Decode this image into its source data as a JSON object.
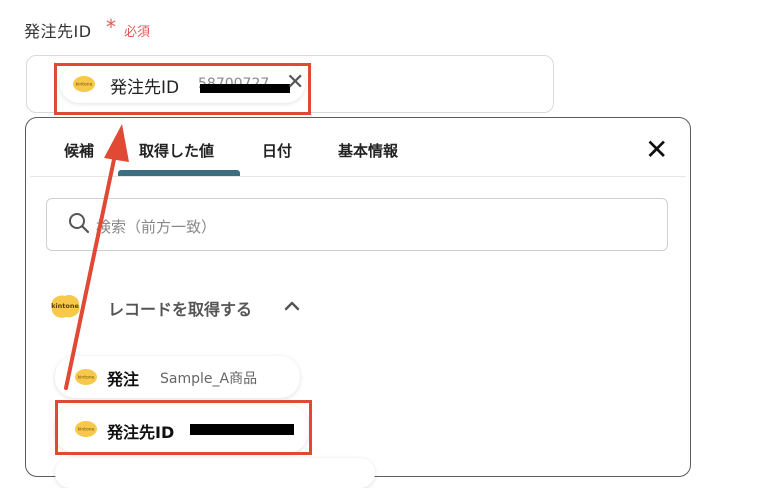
{
  "field": {
    "label": "発注先ID",
    "required_mark": "*",
    "required_text": "必須"
  },
  "selected_chip": {
    "label": "発注先ID",
    "value_partial": "58700727",
    "close_glyph": "✕",
    "icon": "kintone-icon"
  },
  "panel": {
    "tabs": [
      {
        "label": "候補",
        "active": false
      },
      {
        "label": "取得した値",
        "active": true
      },
      {
        "label": "日付",
        "active": false
      },
      {
        "label": "基本情報",
        "active": false
      }
    ],
    "close_glyph": "✕",
    "search": {
      "placeholder": "検索（前方一致）",
      "value": ""
    },
    "group": {
      "logo_text": "kintone",
      "title": "レコードを取得する",
      "expanded": true
    },
    "items": [
      {
        "label": "発注",
        "value": "Sample_A商品"
      },
      {
        "label": "発注先ID",
        "value": ""
      }
    ]
  },
  "colors": {
    "accent_tab": "#3d6e80",
    "highlight": "#e04a35",
    "required": "#e05a55",
    "kintone_yellow": "#f7c84a"
  }
}
